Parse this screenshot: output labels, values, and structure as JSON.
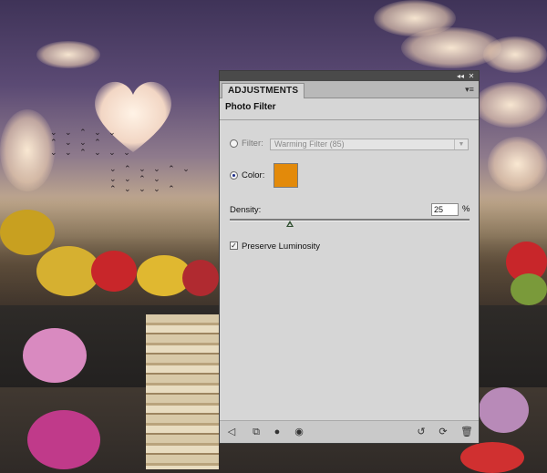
{
  "panel": {
    "tab_label": "ADJUSTMENTS",
    "section_title": "Photo Filter",
    "titlebar_icons": [
      "collapse-icon",
      "close-icon"
    ],
    "menu_icon": "panel-menu-icon"
  },
  "filter": {
    "label": "Filter:",
    "selected_value": "Warming Filter (85)",
    "selected": false
  },
  "color": {
    "label": "Color:",
    "selected": true,
    "swatch": "#e38a0a"
  },
  "density": {
    "label": "Density:",
    "value": "25",
    "unit": "%",
    "level_percent": 25
  },
  "preserve_luminosity": {
    "label": "Preserve Luminosity",
    "checked": true
  },
  "bottom_icons": [
    "back-arrow-icon",
    "clip-to-layer-icon",
    "mask-icon",
    "eye-icon",
    "reset-icon",
    "reset-default-icon",
    "trash-icon"
  ],
  "colors": {
    "panel_bg": "#d6d6d6",
    "titlebar": "#4a4a4a"
  }
}
